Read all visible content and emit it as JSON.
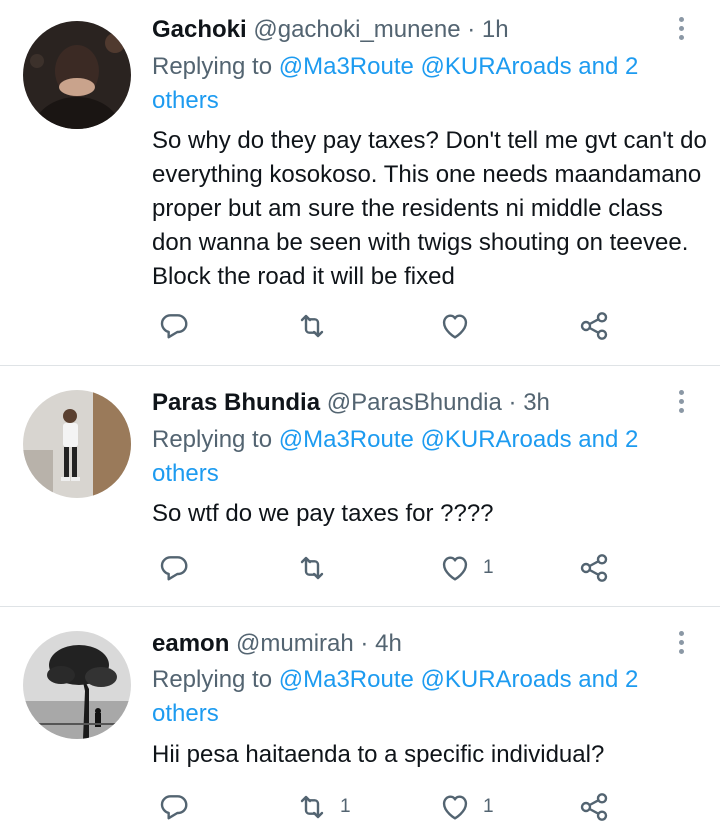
{
  "tweets": [
    {
      "name": "Gachoki",
      "handle": "@gachoki_munene",
      "separator": "·",
      "time": "1h",
      "reply_prefix": "Replying to ",
      "reply_mentions": "@Ma3Route @KURAroads and 2 others",
      "body": "So why do they pay taxes? Don't tell me gvt can't do everything kosokoso. This one needs maandamano proper but am sure the residents ni middle class don wanna be seen with twigs shouting on teevee. Block the road it will be fixed",
      "retweet_count": "",
      "like_count": ""
    },
    {
      "name": "Paras Bhundia",
      "handle": "@ParasBhundia",
      "separator": "·",
      "time": "3h",
      "reply_prefix": "Replying to ",
      "reply_mentions": "@Ma3Route @KURAroads and 2 others",
      "body": "So wtf do we pay taxes for ????",
      "retweet_count": "",
      "like_count": "1"
    },
    {
      "name": "eamon",
      "handle": "@mumirah",
      "separator": "·",
      "time": "4h",
      "reply_prefix": "Replying to ",
      "reply_mentions": "@Ma3Route @KURAroads and 2 others",
      "body": "Hii pesa haitaenda to a specific individual?",
      "retweet_count": "1",
      "like_count": "1"
    }
  ],
  "icons": {
    "reply": "reply-icon",
    "retweet": "retweet-icon",
    "like": "heart-icon",
    "share": "share-icon",
    "more": "more-vertical-icon"
  },
  "colors": {
    "mention": "#1d9bf0",
    "secondary_text": "#536471",
    "icon": "#536471",
    "divider": "#dfe3e6"
  }
}
